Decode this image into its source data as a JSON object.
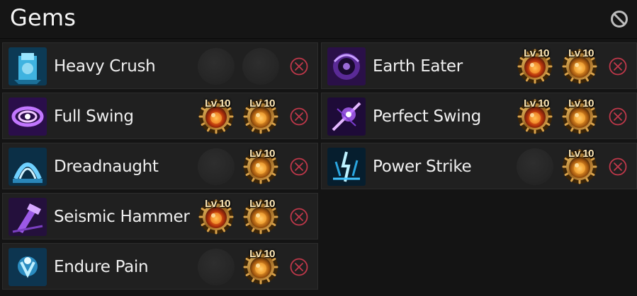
{
  "title": "Gems",
  "header_icon": "ban-icon",
  "colors": {
    "background": "#141414",
    "row_bg": "#202020",
    "remove": "#c0384a",
    "gem_level": "#ffe9b8"
  },
  "left_column": [
    {
      "skill": "Heavy Crush",
      "icon": "heavy-crush-skill-icon",
      "slots": [
        {
          "filled": false
        },
        {
          "filled": false
        }
      ]
    },
    {
      "skill": "Full Swing",
      "icon": "full-swing-skill-icon",
      "slots": [
        {
          "filled": true,
          "level": "Lv 10",
          "type": "red"
        },
        {
          "filled": true,
          "level": "Lv 10",
          "type": "gold"
        }
      ]
    },
    {
      "skill": "Dreadnaught",
      "icon": "dreadnaught-skill-icon",
      "slots": [
        {
          "filled": false
        },
        {
          "filled": true,
          "level": "Lv 10",
          "type": "gold"
        }
      ]
    },
    {
      "skill": "Seismic Hammer",
      "icon": "seismic-hammer-skill-icon",
      "slots": [
        {
          "filled": true,
          "level": "Lv 10",
          "type": "red"
        },
        {
          "filled": true,
          "level": "Lv 10",
          "type": "gold"
        }
      ]
    },
    {
      "skill": "Endure Pain",
      "icon": "endure-pain-skill-icon",
      "slots": [
        {
          "filled": false
        },
        {
          "filled": true,
          "level": "Lv 10",
          "type": "gold"
        }
      ]
    }
  ],
  "right_column": [
    {
      "skill": "Earth Eater",
      "icon": "earth-eater-skill-icon",
      "slots": [
        {
          "filled": true,
          "level": "Lv 10",
          "type": "red"
        },
        {
          "filled": true,
          "level": "Lv 10",
          "type": "gold"
        }
      ]
    },
    {
      "skill": "Perfect Swing",
      "icon": "perfect-swing-skill-icon",
      "slots": [
        {
          "filled": true,
          "level": "Lv 10",
          "type": "red"
        },
        {
          "filled": true,
          "level": "Lv 10",
          "type": "gold"
        }
      ]
    },
    {
      "skill": "Power Strike",
      "icon": "power-strike-skill-icon",
      "slots": [
        {
          "filled": false
        },
        {
          "filled": true,
          "level": "Lv 10",
          "type": "gold"
        }
      ]
    }
  ]
}
